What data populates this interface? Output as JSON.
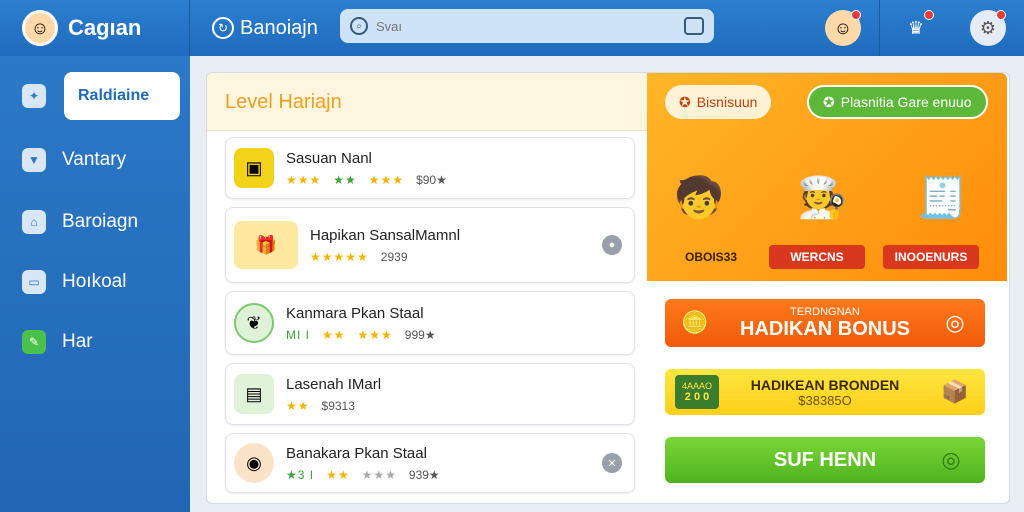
{
  "brand": {
    "name": "Caɡıan"
  },
  "top": {
    "title": "Banoiajn",
    "search_placeholder": "Svaı"
  },
  "sidebar": {
    "items": [
      {
        "label": "Raldiaine",
        "icon": "game-icon",
        "active": true
      },
      {
        "label": "Vantary",
        "icon": "box-icon"
      },
      {
        "label": "Baroiagn",
        "icon": "home-icon"
      },
      {
        "label": "Hoıkoal",
        "icon": "monitor-icon"
      },
      {
        "label": "Har",
        "icon": "pencil-icon"
      }
    ]
  },
  "main": {
    "title": "Level Hariajn",
    "cards": [
      {
        "name": "Sasuan Nanl",
        "stars_g": "★★★",
        "stars_y": "★★",
        "stars_y2": "★★★",
        "value": "$90★"
      },
      {
        "name": "Hapikan SansalMamnl",
        "stars_g": "",
        "stars_y": "★★★★★",
        "stars_y2": "",
        "value": "2939"
      },
      {
        "name": "Kanmara Pkan Staal",
        "stars_g": "MI I",
        "stars_y": "★★",
        "stars_y2": "★★★",
        "value": "999★"
      },
      {
        "name": "Lasenah IMarl",
        "stars_g": "",
        "stars_y": "★★",
        "stars_y2": "",
        "value": "$9313"
      },
      {
        "name": "Banakara Pkan Staal",
        "stars_g": "★3 I",
        "stars_y": "★★",
        "stars_y2": "★★★",
        "value": "939★"
      }
    ]
  },
  "promo": {
    "pill_left": "Bisnisuun",
    "pill_right": "Plasnitia Gare enuuo",
    "label_1": "OBOIS33",
    "label_2": "WERCNS",
    "label_3": "INOOENURS"
  },
  "banners": {
    "orange_sub": "TERDNGNAN",
    "orange_main": "HADIKAN BONUS",
    "yellow_main": "HADIKEAN BRONDEN",
    "yellow_sub": "$38385O",
    "yellow_badge_top": "4AAAO",
    "yellow_badge_bottom": "2 0 0",
    "green_main": "SUF HENN"
  }
}
